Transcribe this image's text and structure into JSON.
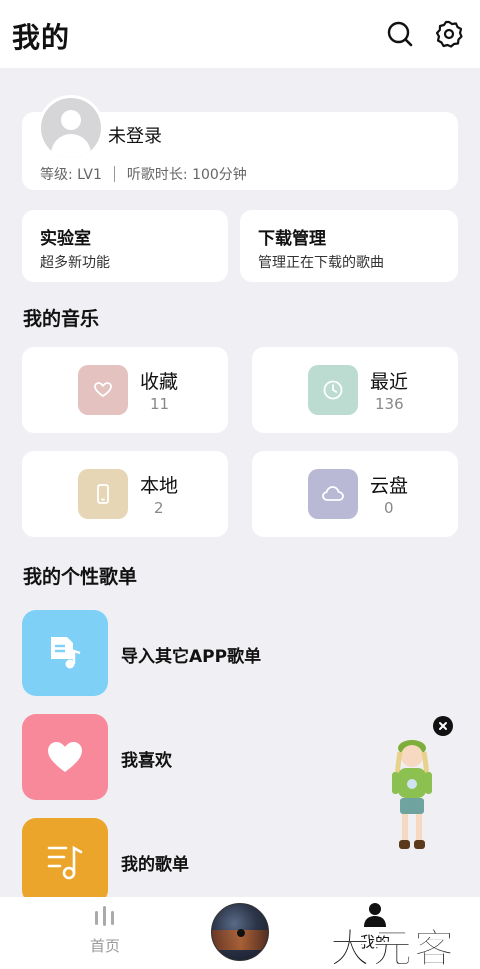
{
  "header": {
    "title": "我的",
    "search_icon": "search-icon",
    "settings_icon": "settings-gear-icon"
  },
  "profile": {
    "name": "未登录",
    "level": "等级: LV1",
    "listen_time": "听歌时长: 100分钟"
  },
  "tools": [
    {
      "title": "实验室",
      "subtitle": "超多新功能"
    },
    {
      "title": "下载管理",
      "subtitle": "管理正在下载的歌曲"
    }
  ],
  "my_music": {
    "title": "我的音乐",
    "items": [
      {
        "label": "收藏",
        "count": "11",
        "icon": "heart-icon",
        "color": "#e3c2bf"
      },
      {
        "label": "最近",
        "count": "136",
        "icon": "clock-icon",
        "color": "#bcdcd1"
      },
      {
        "label": "本地",
        "count": "2",
        "icon": "phone-icon",
        "color": "#e6d6b6"
      },
      {
        "label": "云盘",
        "count": "0",
        "icon": "cloud-icon",
        "color": "#b9b9d6"
      }
    ]
  },
  "playlists": {
    "title": "我的个性歌单",
    "items": [
      {
        "label": "导入其它APP歌单",
        "icon": "import-music-icon",
        "color": "#7fd0f7"
      },
      {
        "label": "我喜欢",
        "icon": "heart-icon",
        "color": "#f7899b"
      },
      {
        "label": "我的歌单",
        "icon": "music-list-icon",
        "color": "#eba52a"
      }
    ]
  },
  "bottom_nav": {
    "home": "首页",
    "mine": "我的"
  },
  "watermark": "大元客"
}
